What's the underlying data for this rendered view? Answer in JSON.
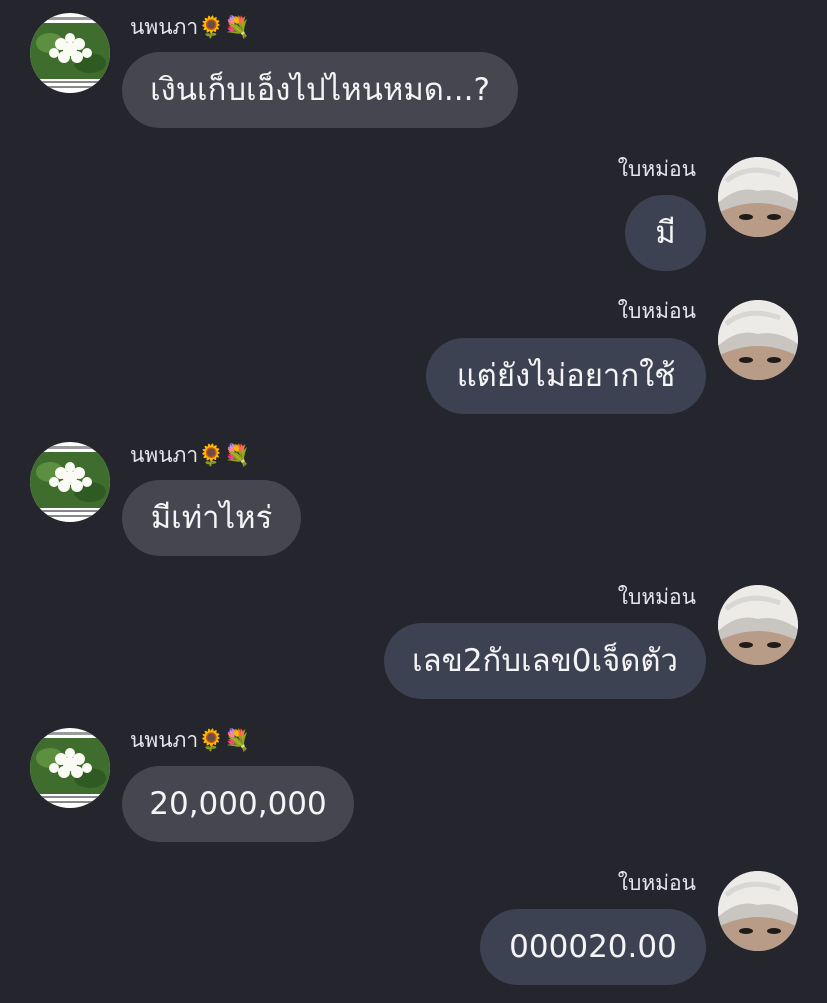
{
  "chat": {
    "incoming_name": "นพนภา🌻💐",
    "outgoing_name": "ใบหม่อน",
    "messages": [
      {
        "side": "incoming",
        "sender": "นพนภา🌻💐",
        "text": "เงินเก็บเอ็งไปไหนหมด...?"
      },
      {
        "side": "outgoing",
        "sender": "ใบหม่อน",
        "text": "มี"
      },
      {
        "side": "outgoing",
        "sender": "ใบหม่อน",
        "text": "แต่ยังไม่อยากใช้"
      },
      {
        "side": "incoming",
        "sender": "นพนภา🌻💐",
        "text": "มีเท่าไหร่"
      },
      {
        "side": "outgoing",
        "sender": "ใบหม่อน",
        "text": "เลข2กับเลข0เจ็ดตัว"
      },
      {
        "side": "incoming",
        "sender": "นพนภา🌻💐",
        "text": "20,000,000"
      },
      {
        "side": "outgoing",
        "sender": "ใบหม่อน",
        "text": "000020.00"
      }
    ]
  },
  "icons": {
    "incoming_avatar": "jasmine-flower-avatar-icon",
    "outgoing_avatar": "person-face-avatar-icon"
  },
  "colors": {
    "background": "#24252d",
    "incoming_bubble": "#45464f",
    "outgoing_bubble": "#3d4252",
    "text": "#f4f4f6"
  }
}
